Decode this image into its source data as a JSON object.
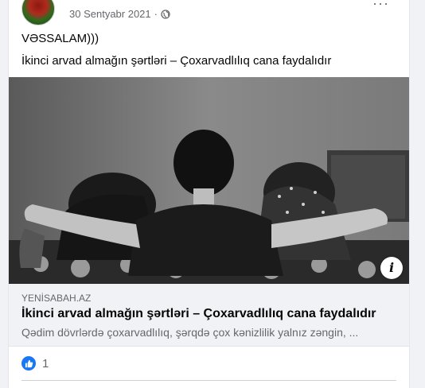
{
  "post": {
    "date": "30 Sentyabr 2021",
    "separator": "·",
    "text_line1": "VƏSSALAM)))",
    "text_line2": "İkinci arvad almağın şərtləri – Çoxarvadlılıq cana faydalıdır"
  },
  "link_preview": {
    "domain": "YENİSABAH.AZ",
    "title": "İkinci arvad almağın şərtləri – Çoxarvadlılıq cana faydalıdır",
    "description": "Qədim dövrlərdə çoxarvadlılıq, şərqdə çox kənizlilik yalnız zəngin, ...",
    "info_icon": "i"
  },
  "reactions": {
    "count": "1",
    "icon": "like-icon"
  },
  "icons": {
    "globe": "globe-icon",
    "more": "more-icon"
  },
  "colors": {
    "accent": "#1877f2",
    "text_primary": "#050505",
    "text_secondary": "#65676b",
    "link_box_bg": "#f0f2f5"
  }
}
